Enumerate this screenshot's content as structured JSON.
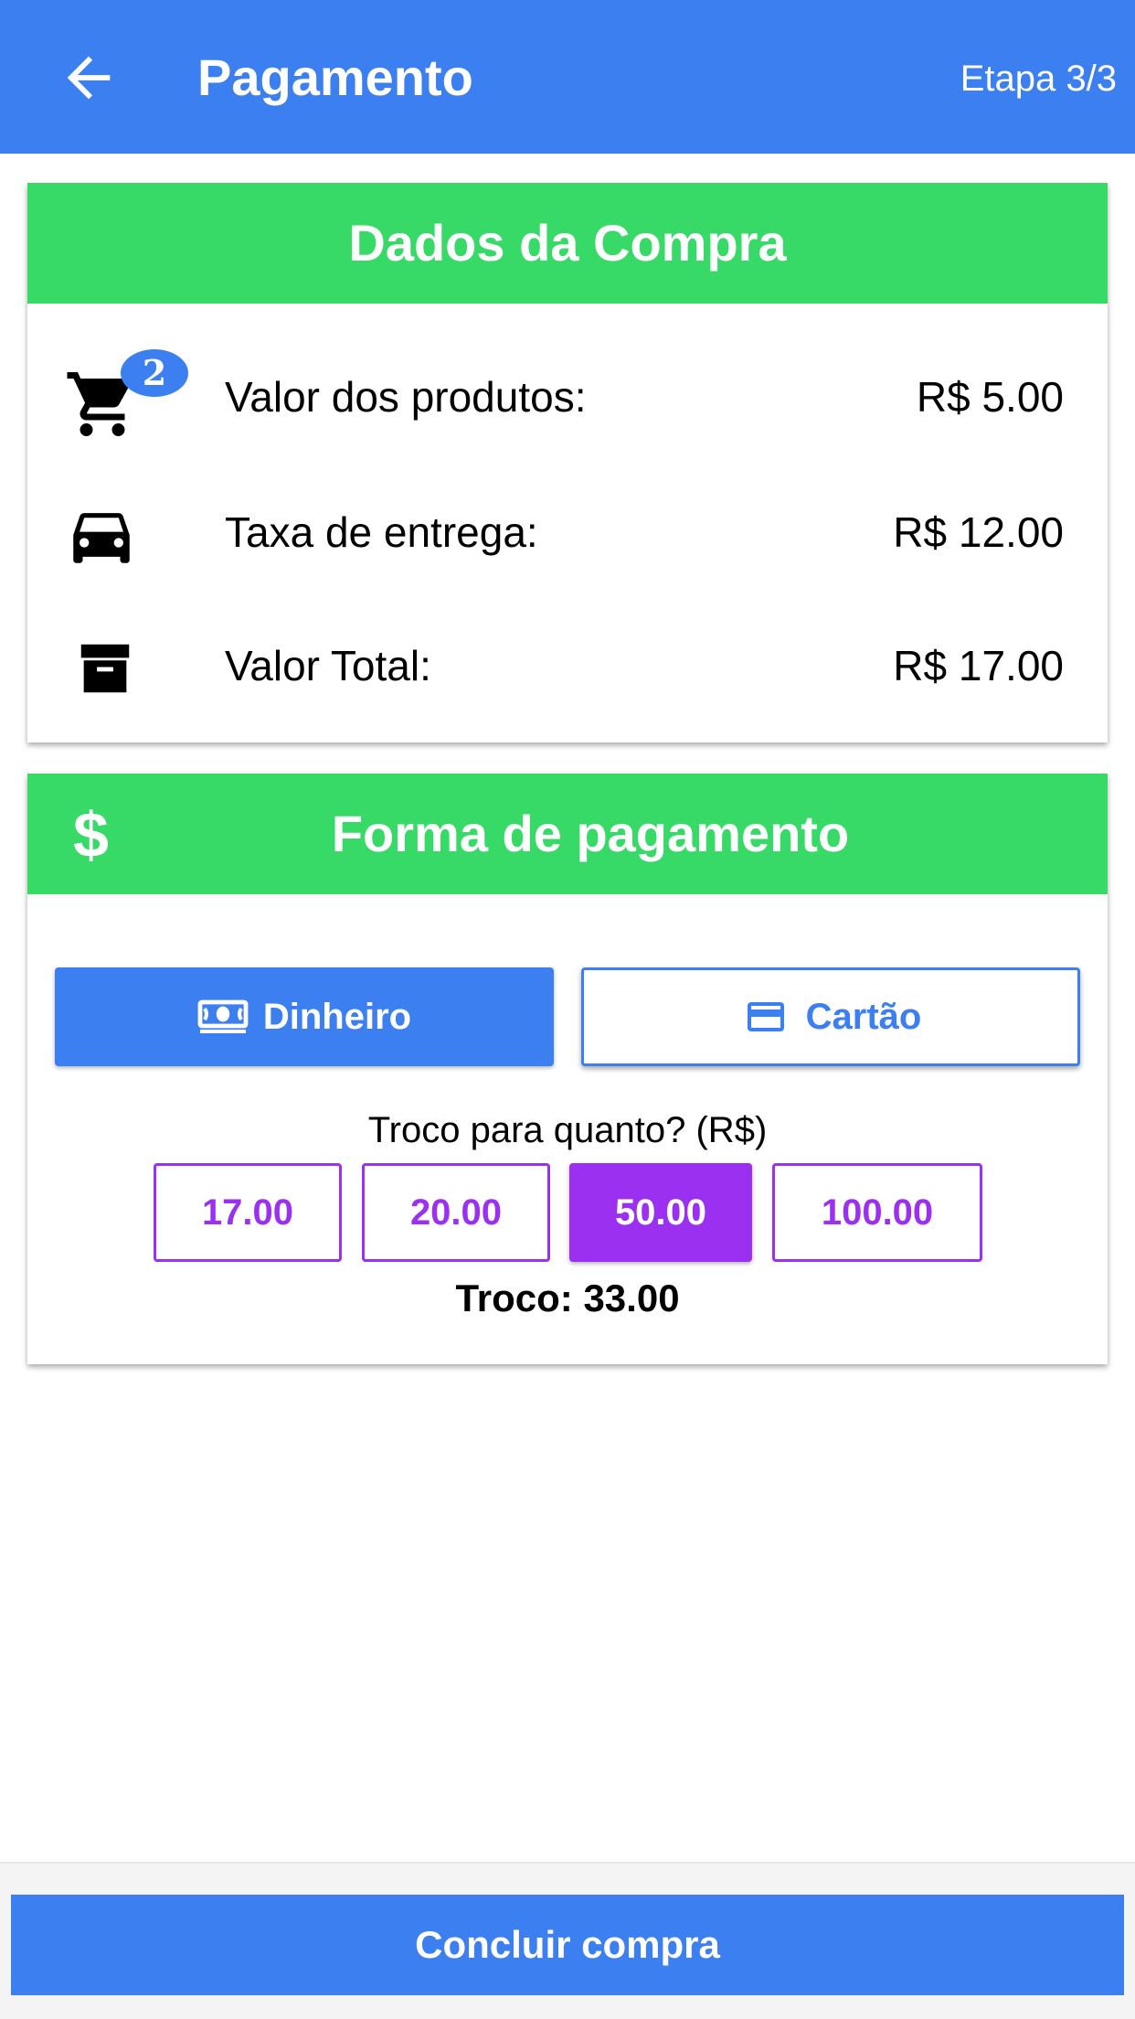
{
  "appbar": {
    "title": "Pagamento",
    "step": "Etapa 3/3",
    "back_icon": "arrow-back-icon"
  },
  "purchase": {
    "title": "Dados da Compra",
    "cart_badge": "2",
    "rows": [
      {
        "icon": "shopping-cart-icon",
        "label": "Valor dos produtos:",
        "value": "R$ 5.00"
      },
      {
        "icon": "car-icon",
        "label": "Taxa de entrega:",
        "value": "R$ 12.00"
      },
      {
        "icon": "archive-box-icon",
        "label": "Valor Total:",
        "value": "R$ 17.00"
      }
    ]
  },
  "payment": {
    "title": "Forma de pagamento",
    "currency_symbol": "$",
    "methods": {
      "cash": {
        "label": "Dinheiro",
        "icon": "money-icon",
        "selected": true
      },
      "card": {
        "label": "Cartão",
        "icon": "credit-card-icon",
        "selected": false
      }
    },
    "change_question": "Troco para quanto? (R$)",
    "change_options": [
      "17.00",
      "20.00",
      "50.00",
      "100.00"
    ],
    "selected_option": "50.00",
    "change_result": "Troco: 33.00"
  },
  "footer": {
    "confirm_label": "Concluir compra"
  },
  "colors": {
    "primary": "#3b7ff0",
    "success": "#37d967",
    "accent": "#9b30f0"
  }
}
